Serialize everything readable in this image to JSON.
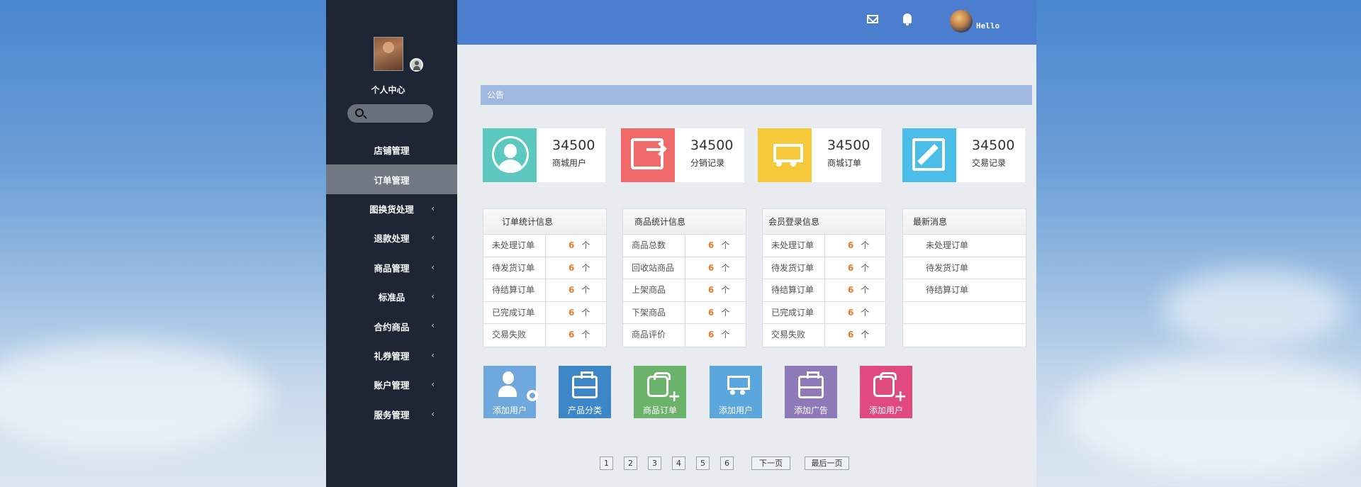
{
  "sidebar": {
    "center_label": "个人中心",
    "items": [
      {
        "label": "店铺管理",
        "chevron": ""
      },
      {
        "label": "订单管理",
        "chevron": ""
      },
      {
        "label": "图换货处理",
        "chevron": "‹"
      },
      {
        "label": "退款处理",
        "chevron": "‹"
      },
      {
        "label": "商品管理",
        "chevron": "‹"
      },
      {
        "label": "标准品",
        "chevron": "‹"
      },
      {
        "label": "合约商品",
        "chevron": "‹"
      },
      {
        "label": "礼券管理",
        "chevron": "‹"
      },
      {
        "label": "账户管理",
        "chevron": "‹"
      },
      {
        "label": "服务管理",
        "chevron": "‹"
      }
    ]
  },
  "header": {
    "greeting": "Hello"
  },
  "notice": {
    "title": "公告"
  },
  "stats": [
    {
      "value": "34500",
      "label": "商城用户",
      "color": "#5cc8c0"
    },
    {
      "value": "34500",
      "label": "分销记录",
      "color": "#f06a6a"
    },
    {
      "value": "34500",
      "label": "商城订单",
      "color": "#f6c93a"
    },
    {
      "value": "34500",
      "label": "交易记录",
      "color": "#4bbde9"
    }
  ],
  "panels": {
    "orders": {
      "title": "订单统计信息",
      "rows": [
        {
          "label": "未处理订单",
          "count": "6",
          "unit": "个"
        },
        {
          "label": "待发货订单",
          "count": "6",
          "unit": "个"
        },
        {
          "label": "待结算订单",
          "count": "6",
          "unit": "个"
        },
        {
          "label": "已完成订单",
          "count": "6",
          "unit": "个"
        },
        {
          "label": "交易失败",
          "count": "6",
          "unit": "个"
        }
      ]
    },
    "products": {
      "title": "商品统计信息",
      "rows": [
        {
          "label": "商品总数",
          "count": "6",
          "unit": "个"
        },
        {
          "label": "回收站商品",
          "count": "6",
          "unit": "个"
        },
        {
          "label": "上架商品",
          "count": "6",
          "unit": "个"
        },
        {
          "label": "下架商品",
          "count": "6",
          "unit": "个"
        },
        {
          "label": "商品评价",
          "count": "6",
          "unit": "个"
        }
      ]
    },
    "members": {
      "title": "会员登录信息",
      "rows": [
        {
          "label": "未处理订单",
          "count": "6",
          "unit": "个"
        },
        {
          "label": "待发货订单",
          "count": "6",
          "unit": "个"
        },
        {
          "label": "待结算订单",
          "count": "6",
          "unit": "个"
        },
        {
          "label": "已完成订单",
          "count": "6",
          "unit": "个"
        },
        {
          "label": "交易失败",
          "count": "6",
          "unit": "个"
        }
      ]
    },
    "news": {
      "title": "最新消息",
      "rows": [
        "未处理订单",
        "待发货订单",
        "待结算订单",
        "",
        ""
      ]
    }
  },
  "shortcuts": [
    {
      "label": "添加用户",
      "color": "#6ea8dc",
      "icon": "user-gear-icon"
    },
    {
      "label": "产品分类",
      "color": "#3d86c8",
      "icon": "briefcase-icon"
    },
    {
      "label": "商品订单",
      "color": "#6bb36b",
      "icon": "basket-add-icon"
    },
    {
      "label": "添加用户",
      "color": "#5ba6dc",
      "icon": "cart-icon"
    },
    {
      "label": "添加广告",
      "color": "#8e7ab8",
      "icon": "briefcase-icon"
    },
    {
      "label": "添加用户",
      "color": "#e04a7e",
      "icon": "basket-add-icon"
    }
  ],
  "pagination": {
    "pages": [
      "1",
      "2",
      "3",
      "4",
      "5",
      "6"
    ],
    "next": "下一页",
    "last": "最后一页"
  }
}
